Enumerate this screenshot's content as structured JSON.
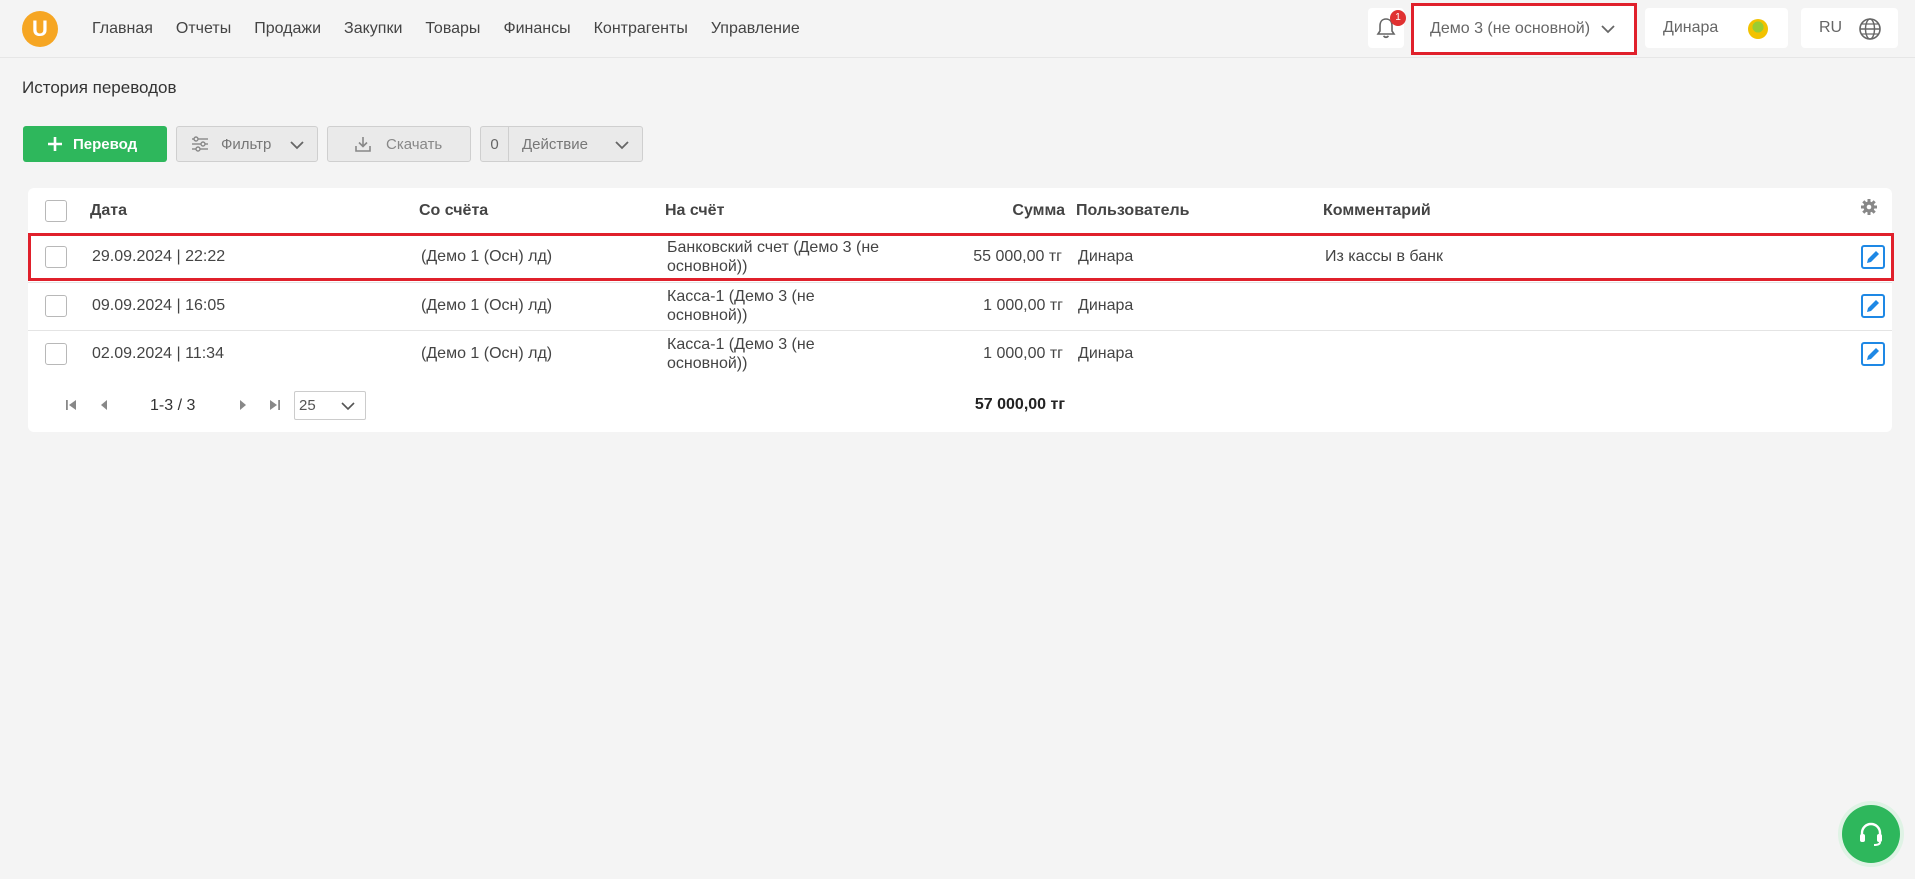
{
  "nav": {
    "items": [
      "Главная",
      "Отчеты",
      "Продажи",
      "Закупки",
      "Товары",
      "Финансы",
      "Контрагенты",
      "Управление"
    ]
  },
  "header": {
    "logo_letter": "U",
    "notification_count": "1",
    "company": "Демо 3 (не основной)",
    "user": "Динара",
    "lang": "RU"
  },
  "page": {
    "title": "История переводов"
  },
  "toolbar": {
    "transfer_label": "Перевод",
    "filter_label": "Фильтр",
    "download_label": "Скачать",
    "action_count": "0",
    "action_label": "Действие"
  },
  "table": {
    "columns": [
      "Дата",
      "Со счёта",
      "На счёт",
      "Сумма",
      "Пользователь",
      "Комментарий"
    ],
    "rows": [
      {
        "date": "29.09.2024 | 22:22",
        "from": "(Демо 1 (Осн) лд)",
        "to_line1": "Банковский счет (Демо 3 (не",
        "to_line2": "основной))",
        "sum": "55 000,00 тг",
        "user": "Динара",
        "comment": "Из кассы в банк"
      },
      {
        "date": "09.09.2024 | 16:05",
        "from": "(Демо 1 (Осн) лд)",
        "to_line1": "Касса-1 (Демо 3 (не",
        "to_line2": "основной))",
        "sum": "1 000,00 тг",
        "user": "Динара",
        "comment": ""
      },
      {
        "date": "02.09.2024 | 11:34",
        "from": "(Демо 1 (Осн) лд)",
        "to_line1": "Касса-1 (Демо 3 (не",
        "to_line2": "основной))",
        "sum": "1 000,00 тг",
        "user": "Динара",
        "comment": ""
      }
    ],
    "total": "57 000,00 тг"
  },
  "pagination": {
    "range": "1-3 / 3",
    "page_size": "25"
  },
  "colors": {
    "accent_green": "#2eb75c",
    "highlight_red": "#e0202b",
    "logo_orange": "#f6a623",
    "edit_blue": "#1e88e5"
  }
}
